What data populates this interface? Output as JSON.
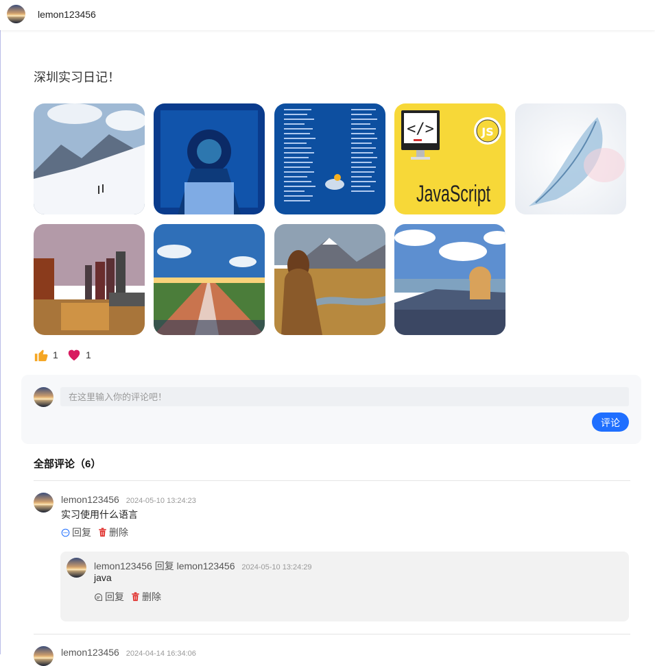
{
  "header": {
    "username": "lemon123456"
  },
  "post": {
    "title": "深圳实习日记！",
    "likes": "1",
    "favorites": "1"
  },
  "comment_form": {
    "placeholder": "在这里输入你的评论吧！",
    "submit_label": "评论"
  },
  "comments_section": {
    "title": "全部评论（6）",
    "comments": [
      {
        "user": "lemon123456",
        "time": "2024-05-10 13:24:23",
        "text": "实习使用什么语言",
        "reply_label": "回复",
        "delete_label": "删除",
        "replies": [
          {
            "user_line": "lemon123456 回复 lemon123456",
            "time": "2024-05-10 13:24:29",
            "text": "java",
            "reply_label": "回复",
            "delete_label": "删除"
          }
        ]
      },
      {
        "user": "lemon123456",
        "time": "2024-04-14 16:34:06"
      }
    ]
  },
  "colors": {
    "accent": "#1f6fff",
    "delete": "#e0302c",
    "like": "#f5a623",
    "heart": "#d81b60"
  }
}
